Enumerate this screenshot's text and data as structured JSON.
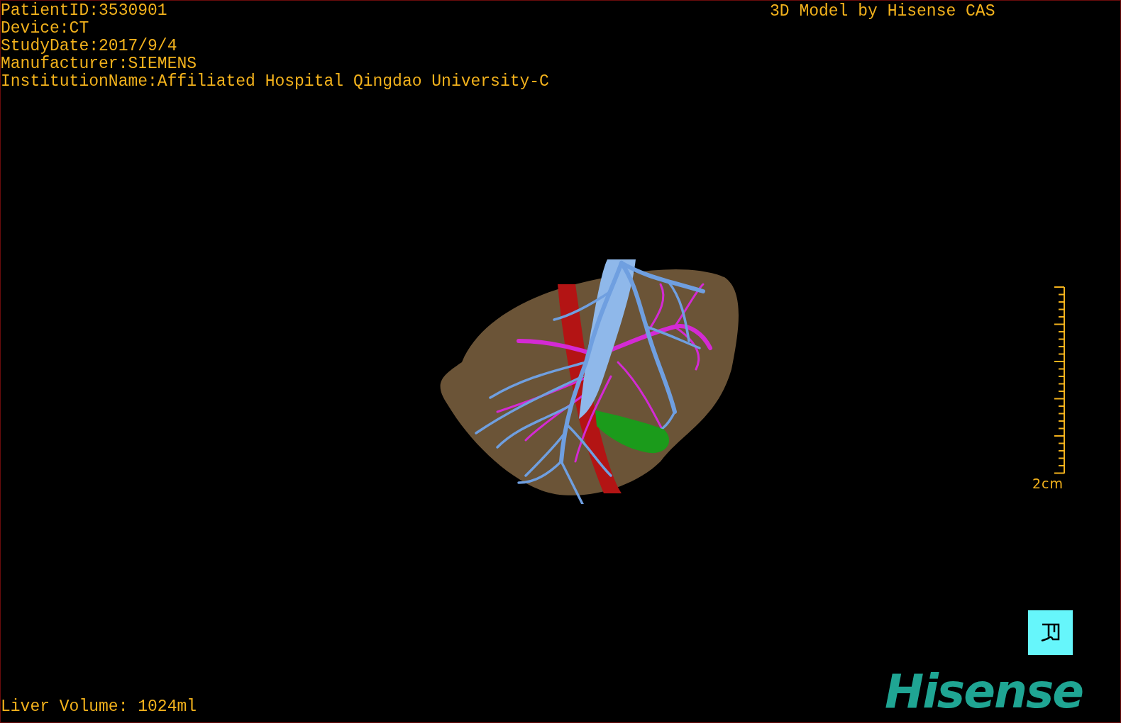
{
  "info_lines": [
    "PatientID:3530901",
    "Device:CT",
    "StudyDate:2017/9/4",
    "Manufacturer:SIEMENS",
    "InstitutionName:Affiliated Hospital Qingdao University-C"
  ],
  "credit": "3D Model by Hisense CAS",
  "scale_bar": {
    "label": "2cm"
  },
  "liver_volume": "Liver Volume: 1024ml",
  "logo": "Hisense"
}
